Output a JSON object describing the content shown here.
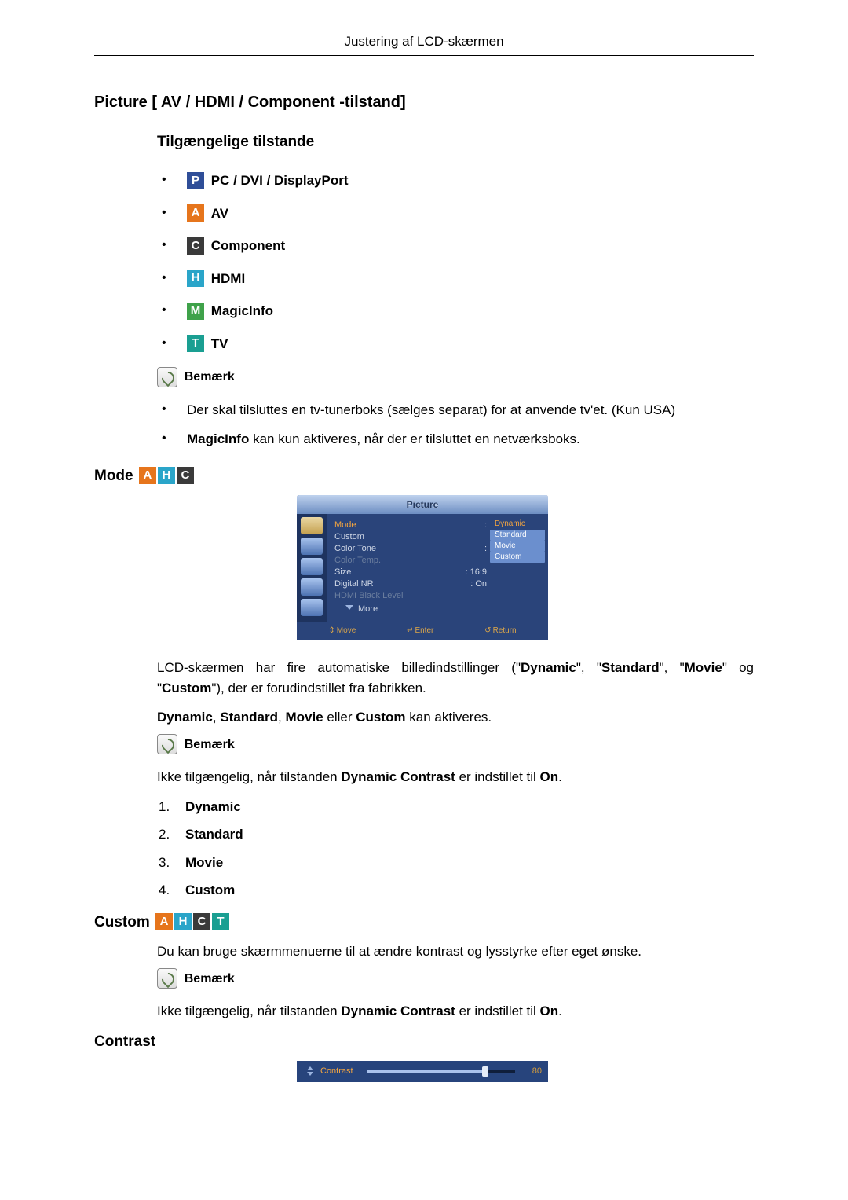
{
  "header": "Justering af LCD-skærmen",
  "picture_section": {
    "title": "Picture [ AV / HDMI / Component -tilstand]",
    "subtitle": "Tilgængelige tilstande",
    "modes": [
      {
        "badge": "P",
        "label": "PC / DVI / DisplayPort"
      },
      {
        "badge": "A",
        "label": "AV"
      },
      {
        "badge": "C",
        "label": "Component"
      },
      {
        "badge": "H",
        "label": "HDMI"
      },
      {
        "badge": "M",
        "label": "MagicInfo"
      },
      {
        "badge": "T",
        "label": "TV"
      }
    ],
    "note_label": "Bemærk",
    "notes": {
      "n1": "Der skal tilsluttes en tv-tunerboks (sælges separat) for at anvende tv'et. (Kun USA)",
      "n2_b": "MagicInfo",
      "n2_r": " kan kun aktiveres, når der er tilsluttet en netværksboks."
    }
  },
  "mode_section": {
    "title": "Mode",
    "osd": {
      "title": "Picture",
      "items": {
        "mode": {
          "label": "Mode"
        },
        "custom": {
          "label": "Custom"
        },
        "ctone": {
          "label": "Color Tone"
        },
        "ctemp": {
          "label": "Color Temp."
        },
        "size": {
          "label": "Size",
          "value": ": 16:9"
        },
        "dnr": {
          "label": "Digital NR",
          "value": ": On"
        },
        "hdmi": {
          "label": "HDMI Black Level"
        },
        "more": {
          "label": "More"
        }
      },
      "options": {
        "o1": "Dynamic",
        "o2": "Standard",
        "o3": "Movie",
        "o4": "Custom"
      },
      "footer": {
        "move": "Move",
        "enter": "Enter",
        "return": "Return"
      }
    },
    "para1_a": "LCD-skærmen har fire automatiske billedindstillinger (\"",
    "para1_b": "Dynamic",
    "para1_c": "\", \"",
    "para1_d": "Standard",
    "para1_e": "\", \"",
    "para1_f": "Movie",
    "para1_g": "\" og \"",
    "para1_h": "Custom",
    "para1_i": "\"), der er forudindstillet fra fabrikken.",
    "para2_a": "Dynamic",
    "para2_b": ", ",
    "para2_c": "Standard",
    "para2_d": ", ",
    "para2_e": "Movie",
    "para2_f": " eller ",
    "para2_g": "Custom",
    "para2_h": " kan aktiveres.",
    "note_label": "Bemærk",
    "note_text_a": "Ikke tilgængelig, når tilstanden ",
    "note_text_b": "Dynamic Contrast",
    "note_text_c": " er indstillet til ",
    "note_text_d": "On",
    "note_text_e": ".",
    "list": {
      "i1": "Dynamic",
      "i2": "Standard",
      "i3": "Movie",
      "i4": "Custom"
    }
  },
  "custom_section": {
    "title": "Custom",
    "para": "Du kan bruge skærmmenuerne til at ændre kontrast og lysstyrke efter eget ønske.",
    "note_label": "Bemærk",
    "note_text_a": "Ikke tilgængelig, når tilstanden ",
    "note_text_b": "Dynamic Contrast",
    "note_text_c": " er indstillet til ",
    "note_text_d": "On",
    "note_text_e": "."
  },
  "contrast_section": {
    "title": "Contrast",
    "slider": {
      "label": "Contrast",
      "value": "80",
      "percent": 80
    }
  }
}
